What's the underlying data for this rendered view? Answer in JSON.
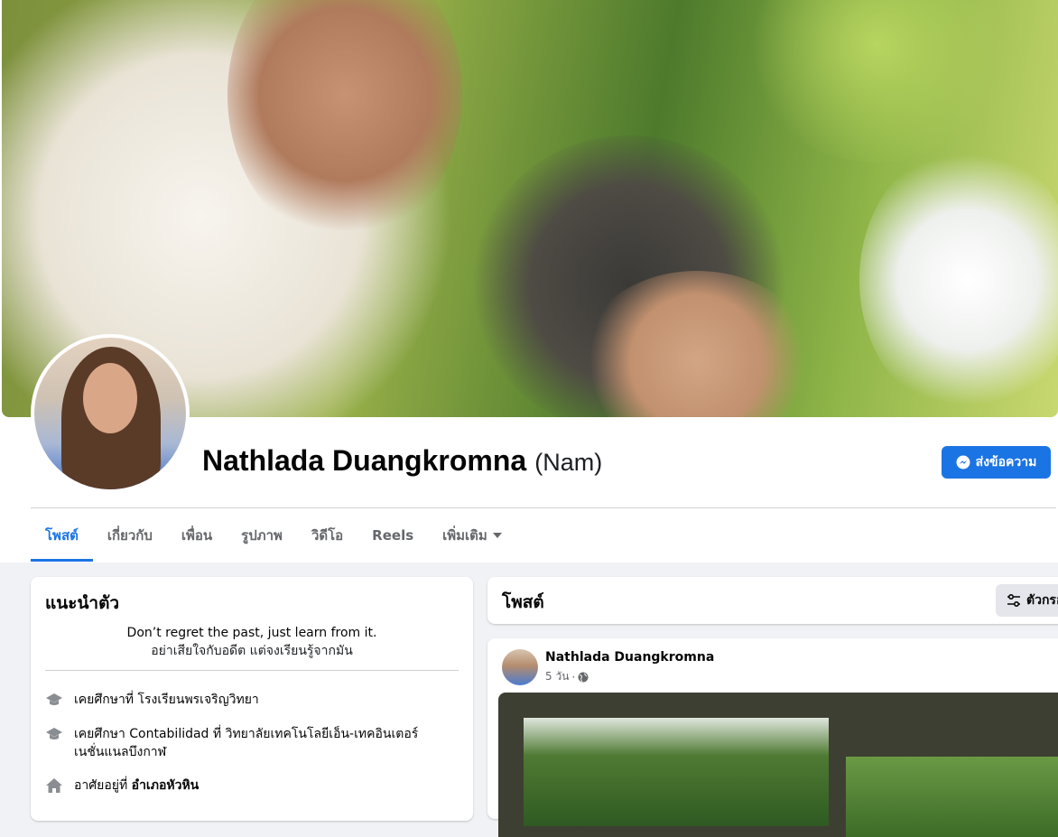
{
  "profile": {
    "name": "Nathlada Duangkromna",
    "alt_name": "(Nam)",
    "message_button": "ส่งข้อความ"
  },
  "tabs": [
    {
      "label": "โพสต์",
      "active": true
    },
    {
      "label": "เกี่ยวกับ"
    },
    {
      "label": "เพื่อน"
    },
    {
      "label": "รูปภาพ"
    },
    {
      "label": "วิดีโอ"
    },
    {
      "label": "Reels"
    },
    {
      "label": "เพิ่มเติม"
    }
  ],
  "intro": {
    "title": "แนะนำตัว",
    "bio_line1": "Don’t regret the past, just learn from it.",
    "bio_line2": "อย่าเสียใจกับอดีต แต่จงเรียนรู้จากมัน",
    "items": [
      {
        "icon": "graduation-cap-icon",
        "text": "เคยศึกษาที่ โรงเรียนพรเจริญวิทยา"
      },
      {
        "icon": "graduation-cap-icon",
        "text": "เคยศึกษา Contabilidad ที่ วิทยาลัยเทคโนโลยีเอ็น-เทคอินเตอร์เนชั่นแนลบึงกาฬ"
      },
      {
        "icon": "home-icon",
        "text_prefix": "อาศัยอยู่ที่",
        "text_bold": "อำเภอหัวหิน"
      }
    ]
  },
  "posts": {
    "title": "โพสต์",
    "filter_label": "ตัวกรอง",
    "post": {
      "author": "Nathlada Duangkromna",
      "time": "5 วัน",
      "separator": "·",
      "privacy_icon": "globe-icon"
    }
  },
  "colors": {
    "accent": "#1b74e4",
    "background": "#f0f2f5",
    "secondary_text": "#65676b"
  }
}
